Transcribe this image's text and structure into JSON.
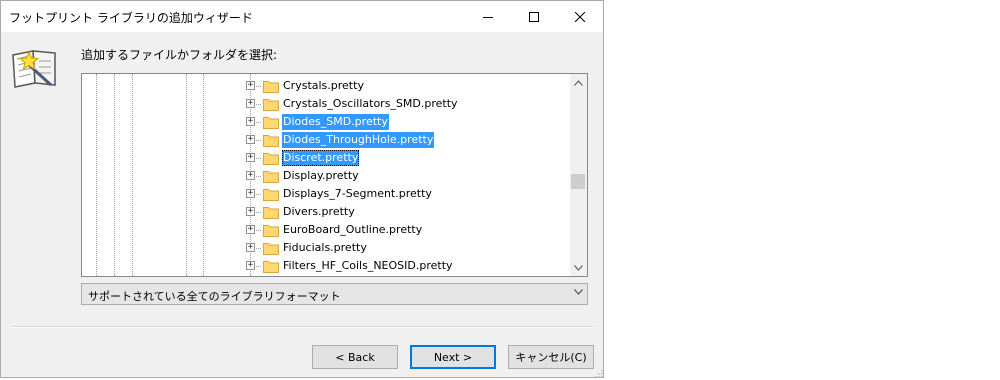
{
  "window": {
    "title": "フットプリント ライブラリの追加ウィザード"
  },
  "prompt": "追加するファイルかフォルダを選択:",
  "tree": {
    "expander_symbol": "+",
    "items": [
      {
        "label": "Crystals.pretty",
        "selected": false
      },
      {
        "label": "Crystals_Oscillators_SMD.pretty",
        "selected": false
      },
      {
        "label": "Diodes_SMD.pretty",
        "selected": true
      },
      {
        "label": "Diodes_ThroughHole.pretty",
        "selected": true
      },
      {
        "label": "Discret.pretty",
        "selected": true,
        "focused": true
      },
      {
        "label": "Display.pretty",
        "selected": false
      },
      {
        "label": "Displays_7-Segment.pretty",
        "selected": false
      },
      {
        "label": "Divers.pretty",
        "selected": false
      },
      {
        "label": "EuroBoard_Outline.pretty",
        "selected": false
      },
      {
        "label": "Fiducials.pretty",
        "selected": false
      },
      {
        "label": "Filters_HF_Coils_NEOSID.pretty",
        "selected": false
      }
    ]
  },
  "filter": {
    "selected": "サポートされている全てのライブラリフォーマット"
  },
  "buttons": {
    "back": "< Back",
    "next": "Next >",
    "cancel": "キャンセル(C)"
  },
  "colors": {
    "selection": "#3399ff",
    "folder": "#ffd86e",
    "default_button_border": "#0078d7"
  },
  "icons": {
    "minimize": "minimize-icon",
    "maximize": "maximize-icon",
    "close": "close-icon",
    "wizard": "book-wand-icon",
    "folder": "folder-icon"
  }
}
